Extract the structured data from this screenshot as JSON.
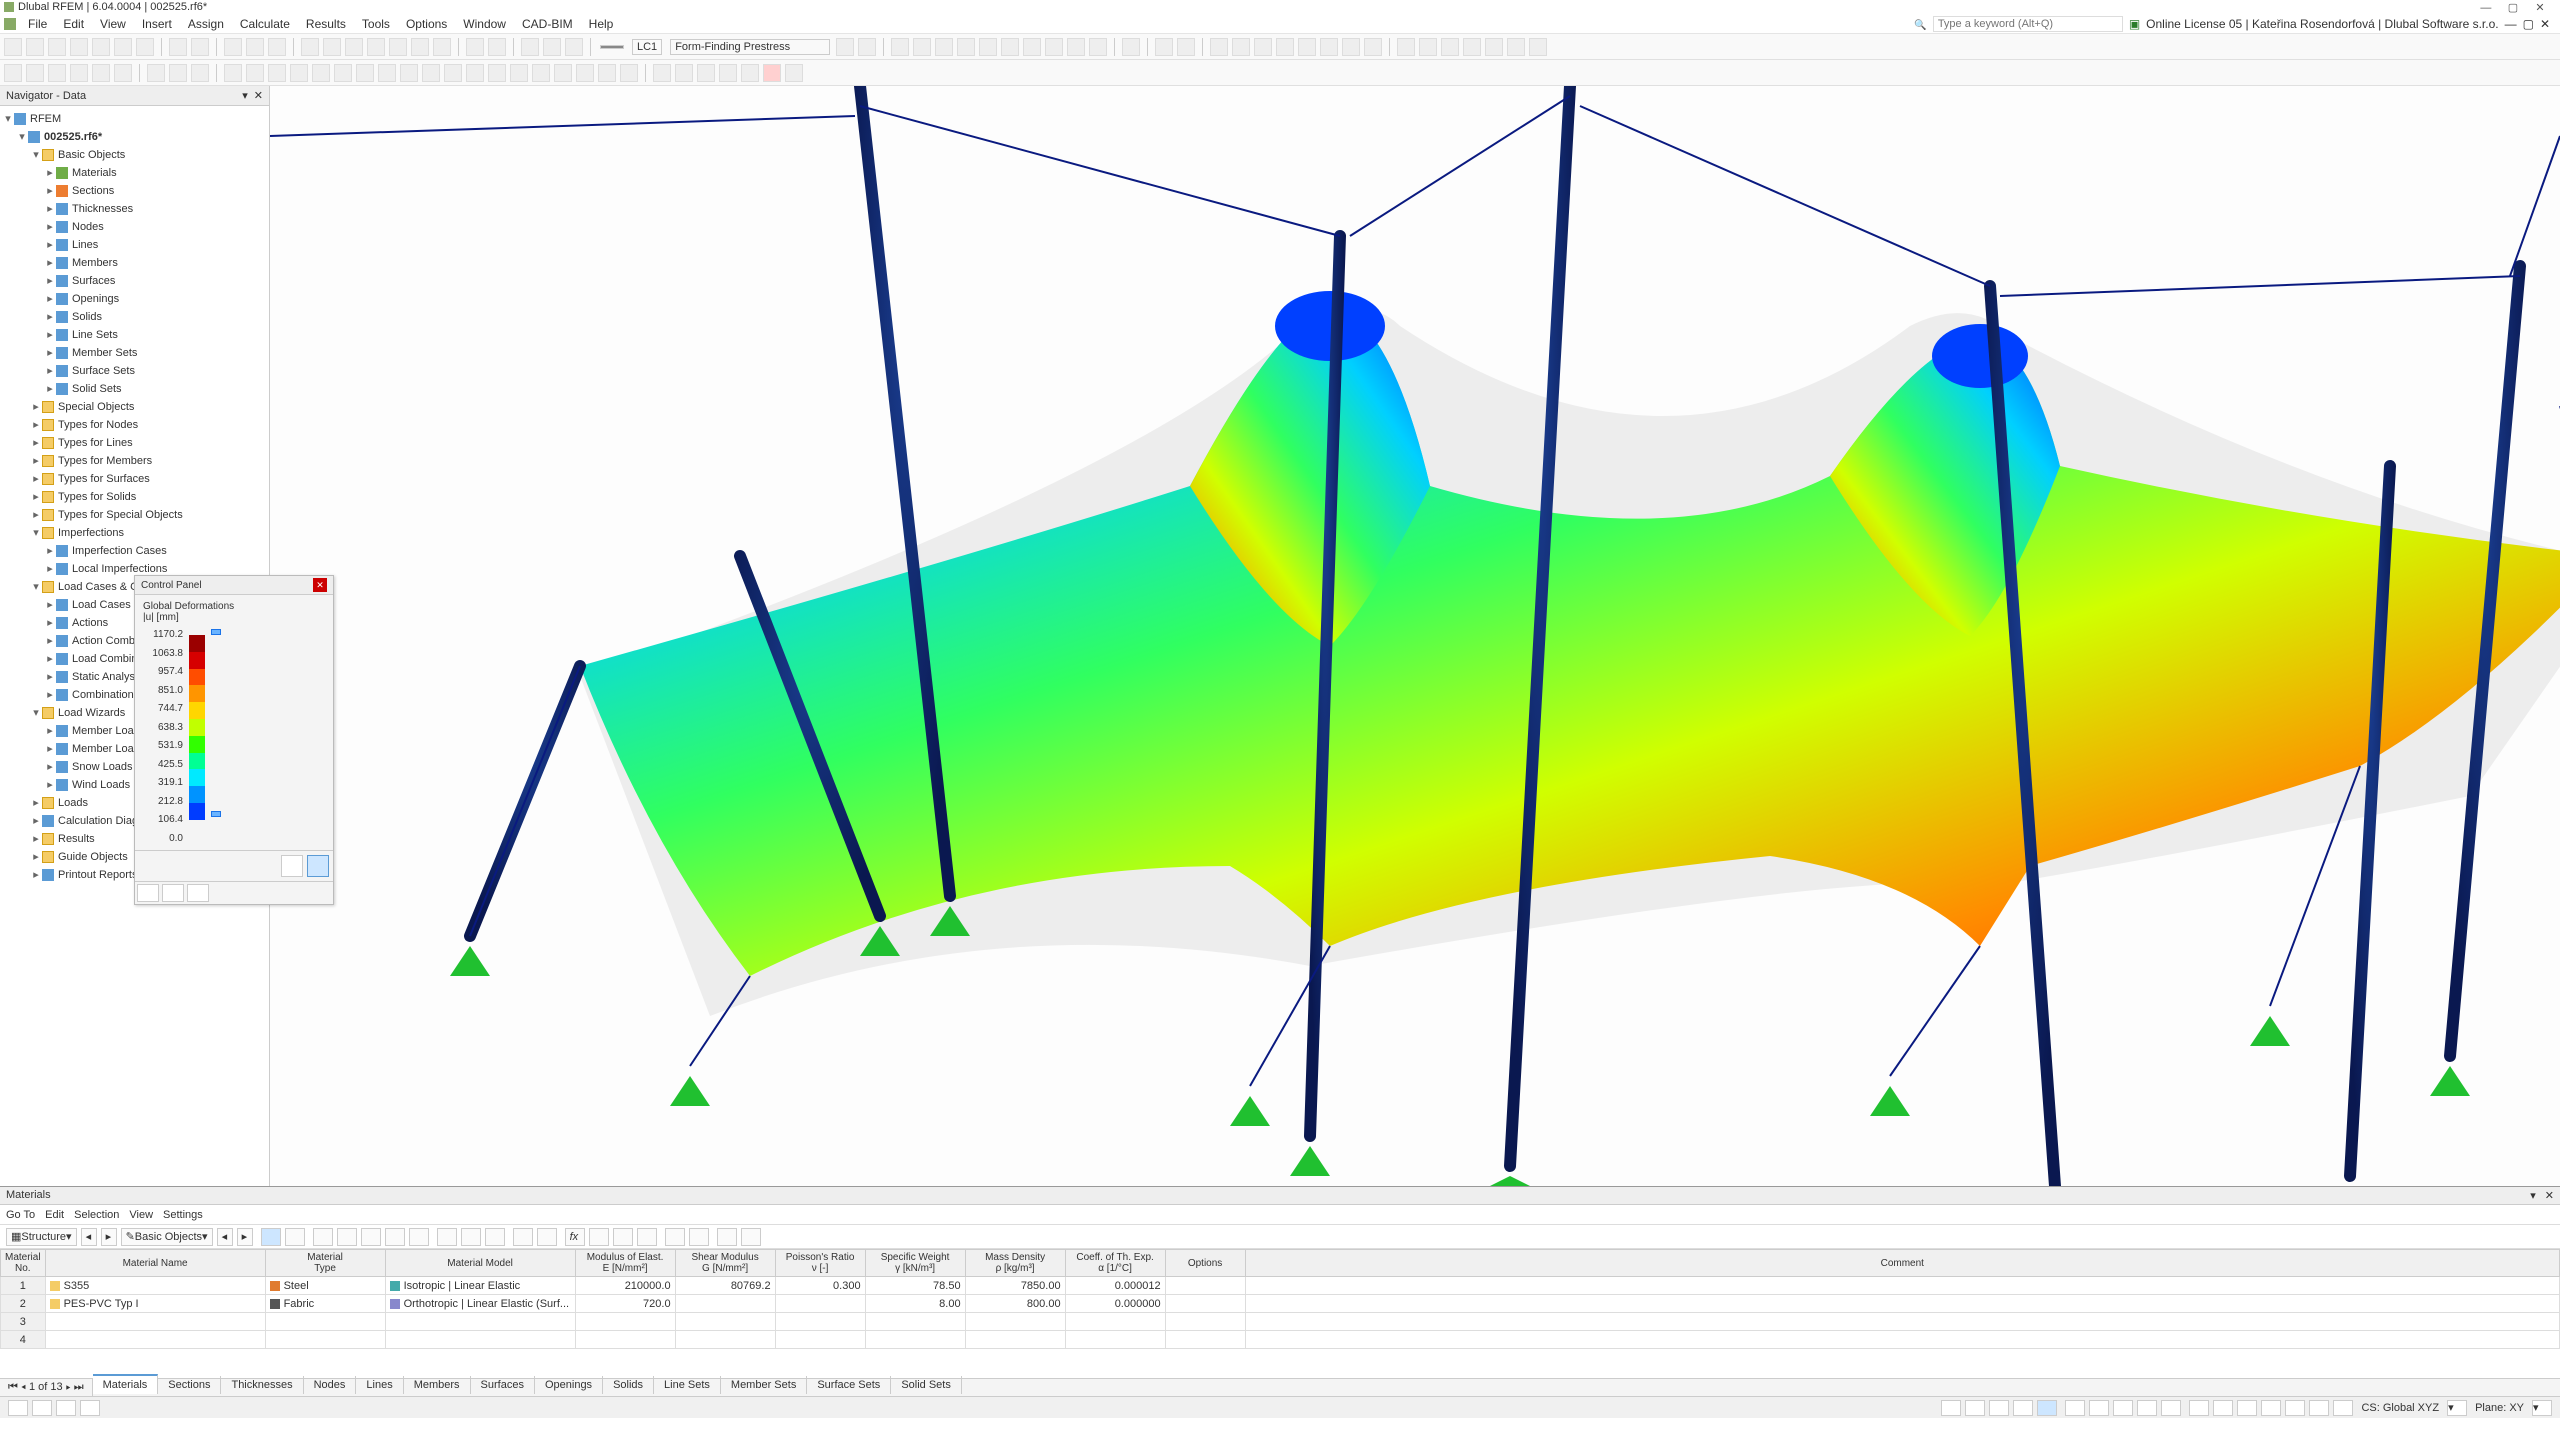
{
  "titlebar": {
    "text": "Dlubal RFEM | 6.04.0004 | 002525.rf6*"
  },
  "menubar": {
    "items": [
      "File",
      "Edit",
      "View",
      "Insert",
      "Assign",
      "Calculate",
      "Results",
      "Tools",
      "Options",
      "Window",
      "CAD-BIM",
      "Help"
    ],
    "search_placeholder": "Type a keyword (Alt+Q)",
    "license_text": "Online License 05 | Kateřina Rosendorfová | Dlubal Software s.r.o."
  },
  "toolbar2": {
    "lc_code": "LC1",
    "lc_name": "Form-Finding Prestress"
  },
  "navigator": {
    "title": "Navigator - Data",
    "root": "RFEM",
    "model": "002525.rf6*",
    "groups": [
      {
        "label": "Basic Objects",
        "expanded": true,
        "children": [
          {
            "label": "Materials",
            "icon": "green"
          },
          {
            "label": "Sections",
            "icon": "orange"
          },
          {
            "label": "Thicknesses",
            "icon": "blue"
          },
          {
            "label": "Nodes",
            "icon": "blue"
          },
          {
            "label": "Lines",
            "icon": "blue"
          },
          {
            "label": "Members",
            "icon": "blue"
          },
          {
            "label": "Surfaces",
            "icon": "blue"
          },
          {
            "label": "Openings",
            "icon": "blue"
          },
          {
            "label": "Solids",
            "icon": "blue"
          },
          {
            "label": "Line Sets",
            "icon": "blue"
          },
          {
            "label": "Member Sets",
            "icon": "blue"
          },
          {
            "label": "Surface Sets",
            "icon": "blue"
          },
          {
            "label": "Solid Sets",
            "icon": "blue"
          }
        ]
      },
      {
        "label": "Special Objects",
        "icon": "folder"
      },
      {
        "label": "Types for Nodes",
        "icon": "folder"
      },
      {
        "label": "Types for Lines",
        "icon": "folder"
      },
      {
        "label": "Types for Members",
        "icon": "folder"
      },
      {
        "label": "Types for Surfaces",
        "icon": "folder"
      },
      {
        "label": "Types for Solids",
        "icon": "folder"
      },
      {
        "label": "Types for Special Objects",
        "icon": "folder"
      },
      {
        "label": "Imperfections",
        "expanded": true,
        "children": [
          {
            "label": "Imperfection Cases",
            "icon": "blue"
          },
          {
            "label": "Local Imperfections",
            "icon": "blue"
          }
        ]
      },
      {
        "label": "Load Cases & Combinations",
        "expanded": true,
        "icon": "folder",
        "children": [
          {
            "label": "Load Cases",
            "icon": "blue"
          },
          {
            "label": "Actions",
            "icon": "blue"
          },
          {
            "label": "Action Combinations",
            "icon": "blue"
          },
          {
            "label": "Load Combinations",
            "icon": "blue"
          },
          {
            "label": "Static Analysis Settings",
            "icon": "blue"
          },
          {
            "label": "Combination Wizards",
            "icon": "blue"
          }
        ]
      },
      {
        "label": "Load Wizards",
        "expanded": true,
        "icon": "folder",
        "children": [
          {
            "label": "Member Loads from Area Load",
            "icon": "blue"
          },
          {
            "label": "Member Loads from Free Line Load",
            "icon": "blue"
          },
          {
            "label": "Snow Loads",
            "icon": "blue"
          },
          {
            "label": "Wind Loads",
            "icon": "blue"
          }
        ]
      },
      {
        "label": "Loads",
        "icon": "folder"
      },
      {
        "label": "Calculation Diagrams",
        "icon": "blue"
      },
      {
        "label": "Results",
        "icon": "folder"
      },
      {
        "label": "Guide Objects",
        "icon": "folder"
      },
      {
        "label": "Printout Reports",
        "icon": "blue"
      }
    ]
  },
  "control_panel": {
    "title": "Control Panel",
    "heading": "Global Deformations",
    "unit": "|u| [mm]",
    "scale_values": [
      "1170.2",
      "1063.8",
      "957.4",
      "851.0",
      "744.7",
      "638.3",
      "531.9",
      "425.5",
      "319.1",
      "212.8",
      "106.4",
      "0.0"
    ],
    "colors": [
      "#9b0000",
      "#d60000",
      "#ff4d00",
      "#ff9500",
      "#ffd600",
      "#c1ff00",
      "#31ff00",
      "#00ff94",
      "#00eaff",
      "#0093ff",
      "#003cff"
    ]
  },
  "chart_data": {
    "type": "heatmap",
    "title": "Global Deformations",
    "series_name": "|u|",
    "unit": "mm",
    "value_label": "|u| [mm]",
    "scale": {
      "min": 0.0,
      "max": 1170.2,
      "ticks": [
        1170.2,
        1063.8,
        957.4,
        851.0,
        744.7,
        638.3,
        531.9,
        425.5,
        319.1,
        212.8,
        106.4,
        0.0
      ],
      "colors": [
        "#9b0000",
        "#d60000",
        "#ff4d00",
        "#ff9500",
        "#ffd600",
        "#c1ff00",
        "#31ff00",
        "#00ff94",
        "#00eaff",
        "#0093ff",
        "#003cff"
      ]
    },
    "slider_range": [
      0.0,
      1170.2
    ]
  },
  "materials": {
    "title": "Materials",
    "tb": [
      "Go To",
      "Edit",
      "Selection",
      "View",
      "Settings"
    ],
    "combo1": "Structure",
    "combo2": "Basic Objects",
    "columns": [
      {
        "line1": "Material",
        "line2": "No."
      },
      {
        "line1": "",
        "line2": "Material Name"
      },
      {
        "line1": "Material",
        "line2": "Type"
      },
      {
        "line1": "",
        "line2": "Material Model"
      },
      {
        "line1": "Modulus of Elast.",
        "line2": "E [N/mm²]"
      },
      {
        "line1": "Shear Modulus",
        "line2": "G [N/mm²]"
      },
      {
        "line1": "Poisson's Ratio",
        "line2": "ν [-]"
      },
      {
        "line1": "Specific Weight",
        "line2": "γ [kN/m³]"
      },
      {
        "line1": "Mass Density",
        "line2": "ρ [kg/m³]"
      },
      {
        "line1": "Coeff. of Th. Exp.",
        "line2": "α [1/°C]"
      },
      {
        "line1": "",
        "line2": "Options"
      },
      {
        "line1": "",
        "line2": "Comment"
      }
    ],
    "rows": [
      {
        "no": "1",
        "name": "S355",
        "type": "Steel",
        "type_color": "#e07b2f",
        "model": "Isotropic | Linear Elastic",
        "model_color": "#4aa",
        "E": "210000.0",
        "G": "80769.2",
        "nu": "0.300",
        "gamma": "78.50",
        "rho": "7850.00",
        "alpha": "0.000012"
      },
      {
        "no": "2",
        "name": "PES-PVC Typ I",
        "type": "Fabric",
        "type_color": "#555",
        "model": "Orthotropic | Linear Elastic (Surf...",
        "model_color": "#88c",
        "E": "720.0",
        "G": "",
        "nu": "",
        "gamma": "8.00",
        "rho": "800.00",
        "alpha": "0.000000"
      }
    ],
    "pager": "1 of 13",
    "tabs": [
      "Materials",
      "Sections",
      "Thicknesses",
      "Nodes",
      "Lines",
      "Members",
      "Surfaces",
      "Openings",
      "Solids",
      "Line Sets",
      "Member Sets",
      "Surface Sets",
      "Solid Sets"
    ]
  },
  "statusbar": {
    "cs": "CS: Global XYZ",
    "plane": "Plane: XY"
  }
}
